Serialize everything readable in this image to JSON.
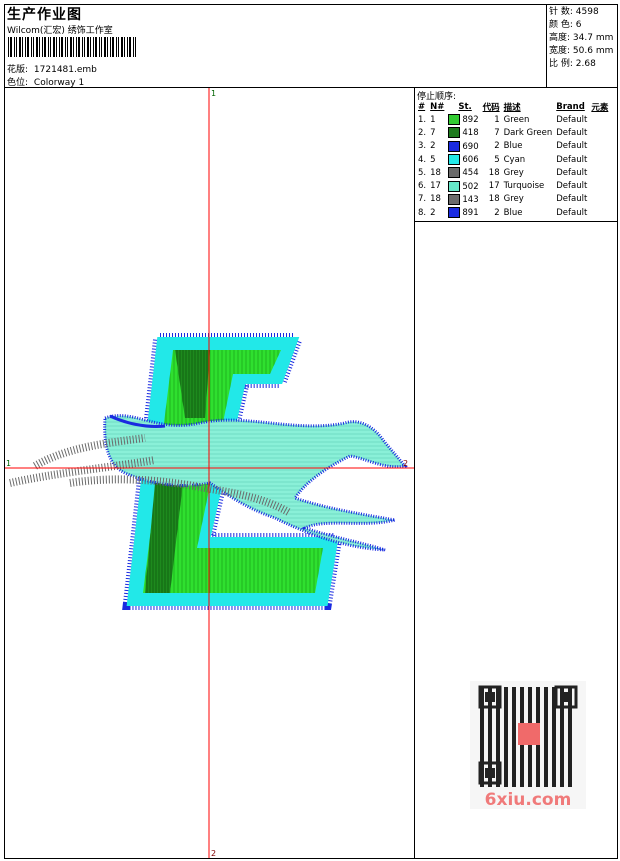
{
  "header": {
    "title": "生产作业图",
    "subtitle": "Wilcom(汇宏) 绣饰工作室",
    "design_label": "花版:",
    "design_value": "1721481.emb",
    "colorway_label": "色位:",
    "colorway_value": "Colorway 1"
  },
  "stats": {
    "stitches_label": "针 数:",
    "stitches_value": "4598",
    "colors_label": "颜 色:",
    "colors_value": "6",
    "height_label": "高度:",
    "height_value": "34.7 mm",
    "width_label": "宽度:",
    "width_value": "50.6 mm",
    "scale_label": "比 例:",
    "scale_value": "2.68"
  },
  "sequence": {
    "label": "停止顺序:",
    "headers": [
      "#",
      "N#",
      "St.",
      "代码",
      "描述",
      "Brand",
      "元素"
    ],
    "rows": [
      {
        "idx": "1.",
        "n": "1",
        "color": "#33cc33",
        "st": "892",
        "code": "1",
        "desc": "Green",
        "brand": "Default"
      },
      {
        "idx": "2.",
        "n": "7",
        "color": "#1e7a1e",
        "st": "418",
        "code": "7",
        "desc": "Dark Green",
        "brand": "Default"
      },
      {
        "idx": "3.",
        "n": "2",
        "color": "#1a2be0",
        "st": "690",
        "code": "2",
        "desc": "Blue",
        "brand": "Default"
      },
      {
        "idx": "4.",
        "n": "5",
        "color": "#22e8e8",
        "st": "606",
        "code": "5",
        "desc": "Cyan",
        "brand": "Default"
      },
      {
        "idx": "5.",
        "n": "18",
        "color": "#6b6b6b",
        "st": "454",
        "code": "18",
        "desc": "Grey",
        "brand": "Default"
      },
      {
        "idx": "6.",
        "n": "17",
        "color": "#66e8c8",
        "st": "502",
        "code": "17",
        "desc": "Turquoise",
        "brand": "Default"
      },
      {
        "idx": "7.",
        "n": "18",
        "color": "#6b6b6b",
        "st": "143",
        "code": "18",
        "desc": "Grey",
        "brand": "Default"
      },
      {
        "idx": "8.",
        "n": "2",
        "color": "#1a2be0",
        "st": "891",
        "code": "2",
        "desc": "Blue",
        "brand": "Default"
      }
    ]
  },
  "axes": {
    "top_label": "1",
    "bottom_label": "2",
    "left_label": "1",
    "right_label": "2"
  },
  "watermark": {
    "text": "6xiu.com"
  }
}
